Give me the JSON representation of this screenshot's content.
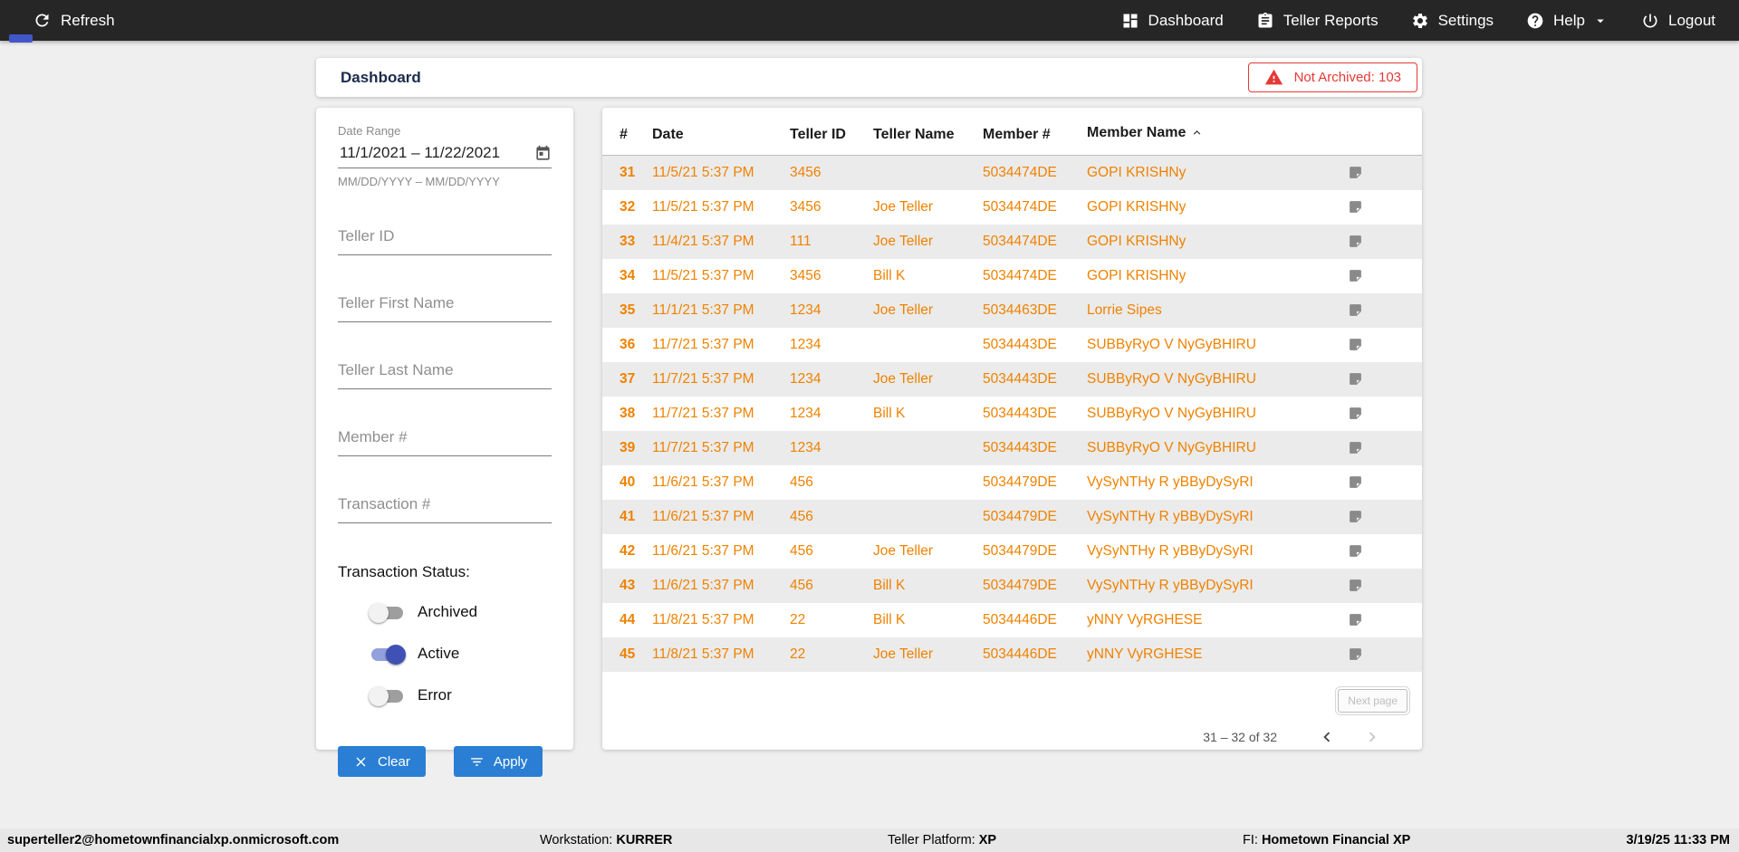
{
  "colors": {
    "accent": "#2a7fd4",
    "orange": "#ef8200",
    "red": "#e53935",
    "toggle-on": "#3f51b5",
    "toggle-on-track": "#92a0dc",
    "topbar-bg": "#262626",
    "page-bg": "#efefef",
    "statusbar-bg": "#e7e7e7",
    "row-alt": "#ebebeb",
    "title": "#1b2b4d"
  },
  "topbar": {
    "refresh_label": "Refresh",
    "nav_items": [
      {
        "label": "Dashboard",
        "icon": "dashboard-icon"
      },
      {
        "label": "Teller Reports",
        "icon": "teller-reports-icon"
      },
      {
        "label": "Settings",
        "icon": "settings-icon"
      },
      {
        "label": "Help",
        "icon": "help-icon"
      },
      {
        "label": "Logout",
        "icon": "logout-icon"
      }
    ]
  },
  "header": {
    "title": "Dashboard",
    "not_archived_label": "Not Archived: 103"
  },
  "filters": {
    "date_range_label": "Date Range",
    "date_range_value": "11/1/2021 – 11/22/2021",
    "date_range_hint": "MM/DD/YYYY – MM/DD/YYYY",
    "fields": [
      {
        "placeholder": "Teller ID"
      },
      {
        "placeholder": "Teller First Name"
      },
      {
        "placeholder": "Teller Last Name"
      },
      {
        "placeholder": "Member #"
      },
      {
        "placeholder": "Transaction #"
      }
    ],
    "status_label": "Transaction Status:",
    "toggles": [
      {
        "label": "Archived",
        "on": false
      },
      {
        "label": "Active",
        "on": true
      },
      {
        "label": "Error",
        "on": false
      }
    ],
    "clear_label": "Clear",
    "apply_label": "Apply"
  },
  "table": {
    "columns": [
      "#",
      "Date",
      "Teller ID",
      "Teller Name",
      "Member #",
      "Member Name"
    ],
    "sort_column": "Member Name",
    "sort_direction": "asc",
    "rows": [
      {
        "num": "31",
        "date": "11/5/21 5:37 PM",
        "teller_id": "3456",
        "teller_name": "",
        "member_num": "5034474DE",
        "member_name": "GOPI KRISHNy"
      },
      {
        "num": "32",
        "date": "11/5/21 5:37 PM",
        "teller_id": "3456",
        "teller_name": "Joe Teller",
        "member_num": "5034474DE",
        "member_name": "GOPI KRISHNy"
      },
      {
        "num": "33",
        "date": "11/4/21 5:37 PM",
        "teller_id": "111",
        "teller_name": "Joe Teller",
        "member_num": "5034474DE",
        "member_name": "GOPI KRISHNy"
      },
      {
        "num": "34",
        "date": "11/5/21 5:37 PM",
        "teller_id": "3456",
        "teller_name": "Bill K",
        "member_num": "5034474DE",
        "member_name": "GOPI KRISHNy"
      },
      {
        "num": "35",
        "date": "11/1/21 5:37 PM",
        "teller_id": "1234",
        "teller_name": "Joe Teller",
        "member_num": "5034463DE",
        "member_name": "Lorrie Sipes"
      },
      {
        "num": "36",
        "date": "11/7/21 5:37 PM",
        "teller_id": "1234",
        "teller_name": "",
        "member_num": "5034443DE",
        "member_name": "SUBByRyO V NyGyBHIRU"
      },
      {
        "num": "37",
        "date": "11/7/21 5:37 PM",
        "teller_id": "1234",
        "teller_name": "Joe Teller",
        "member_num": "5034443DE",
        "member_name": "SUBByRyO V NyGyBHIRU"
      },
      {
        "num": "38",
        "date": "11/7/21 5:37 PM",
        "teller_id": "1234",
        "teller_name": "Bill K",
        "member_num": "5034443DE",
        "member_name": "SUBByRyO V NyGyBHIRU"
      },
      {
        "num": "39",
        "date": "11/7/21 5:37 PM",
        "teller_id": "1234",
        "teller_name": "",
        "member_num": "5034443DE",
        "member_name": "SUBByRyO V NyGyBHIRU"
      },
      {
        "num": "40",
        "date": "11/6/21 5:37 PM",
        "teller_id": "456",
        "teller_name": "",
        "member_num": "5034479DE",
        "member_name": "VySyNTHy R yBByDySyRI"
      },
      {
        "num": "41",
        "date": "11/6/21 5:37 PM",
        "teller_id": "456",
        "teller_name": "",
        "member_num": "5034479DE",
        "member_name": "VySyNTHy R yBByDySyRI"
      },
      {
        "num": "42",
        "date": "11/6/21 5:37 PM",
        "teller_id": "456",
        "teller_name": "Joe Teller",
        "member_num": "5034479DE",
        "member_name": "VySyNTHy R yBByDySyRI"
      },
      {
        "num": "43",
        "date": "11/6/21 5:37 PM",
        "teller_id": "456",
        "teller_name": "Bill K",
        "member_num": "5034479DE",
        "member_name": "VySyNTHy R yBByDySyRI"
      },
      {
        "num": "44",
        "date": "11/8/21 5:37 PM",
        "teller_id": "22",
        "teller_name": "Bill K",
        "member_num": "5034446DE",
        "member_name": "yNNY VyRGHESE"
      },
      {
        "num": "45",
        "date": "11/8/21 5:37 PM",
        "teller_id": "22",
        "teller_name": "Joe Teller",
        "member_num": "5034446DE",
        "member_name": "yNNY VyRGHESE"
      }
    ],
    "pagination": {
      "next_page_label": "Next page",
      "range_label": "31 – 32 of 32"
    }
  },
  "statusbar": {
    "user": "superteller2@hometownfinancialxp.onmicrosoft.com",
    "workstation_label": "Workstation: ",
    "workstation_value": "KURRER",
    "platform_label": "Teller Platform: ",
    "platform_value": "XP",
    "fi_label": "FI: ",
    "fi_value": "Hometown Financial XP",
    "timestamp": "3/19/25 11:33 PM"
  }
}
